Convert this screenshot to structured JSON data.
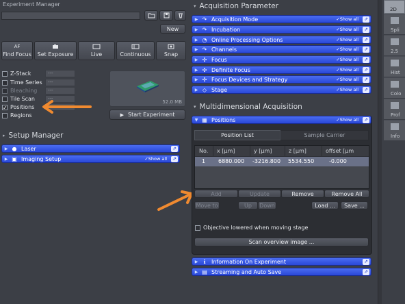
{
  "experiment_manager": {
    "title": "Experiment Manager",
    "new_label": "New",
    "acq_buttons": [
      {
        "icon": "AF",
        "label": "Find Focus"
      },
      {
        "icon": "camera-icon",
        "label": "Set Exposure"
      },
      {
        "icon": "live-icon",
        "label": "Live"
      },
      {
        "icon": "continuous-icon",
        "label": "Continuous"
      },
      {
        "icon": "snap-icon",
        "label": "Snap"
      }
    ],
    "options": [
      {
        "label": "Z-Stack",
        "checked": false,
        "value": "---"
      },
      {
        "label": "Time Series",
        "checked": false,
        "value": "---"
      },
      {
        "label": "Bleaching",
        "checked": false,
        "value": "---"
      },
      {
        "label": "Tile Scan",
        "checked": false,
        "value": "---"
      },
      {
        "label": "Positions",
        "checked": true,
        "value": "---"
      },
      {
        "label": "Regions",
        "checked": false,
        "value": ""
      }
    ],
    "preview_size": "52.0 MB",
    "start_label": "Start Experiment"
  },
  "setup_manager": {
    "title": "Setup Manager",
    "items": [
      {
        "label": "Laser",
        "show_all": ""
      },
      {
        "label": "Imaging Setup",
        "show_all": "Show all"
      }
    ]
  },
  "acquisition_parameter": {
    "title": "Acquisition Parameter",
    "items": [
      {
        "label": "Acquisition Mode",
        "show_all": "Show all"
      },
      {
        "label": "Incubation",
        "show_all": "Show all"
      },
      {
        "label": "Online Processing Options",
        "show_all": "Show all"
      },
      {
        "label": "Channels",
        "show_all": "Show all"
      },
      {
        "label": "Focus",
        "show_all": "Show all"
      },
      {
        "label": "Definite Focus",
        "show_all": "Show all"
      },
      {
        "label": "Focus Devices and Strategy",
        "show_all": "Show all"
      },
      {
        "label": "Stage",
        "show_all": "Show all"
      }
    ]
  },
  "multidimensional": {
    "title": "Multidimensional Acquisition",
    "positions": {
      "label": "Positions",
      "show_all": "Show all",
      "tabs": [
        "Position List",
        "Sample Carrier"
      ],
      "columns": [
        "No.",
        "x [µm]",
        "y [µm]",
        "z [µm]",
        "offset [µm"
      ],
      "rows": [
        [
          "1",
          "6880.000",
          "-3216.800",
          "5534.550",
          "-0.000"
        ]
      ],
      "buttons": {
        "add": "Add",
        "update": "Update",
        "remove": "Remove",
        "remove_all": "Remove All",
        "move_to": "Move to",
        "up": "Up",
        "down": "Down",
        "load": "Load ...",
        "save": "Save ..."
      },
      "objective_label": "Objective lowered when moving stage",
      "scan_label": "Scan overview image ..."
    },
    "footer_items": [
      {
        "label": "Information On Experiment"
      },
      {
        "label": "Streaming and Auto Save"
      }
    ]
  },
  "right_strip": {
    "items": [
      "2D",
      "Spli",
      "2.5",
      "Hist",
      "Colo",
      "Prof",
      "Info"
    ]
  },
  "colors": {
    "accent_blue": "#2f50e0",
    "annotation_arrow": "#f08a30",
    "bg": "#3c3f46"
  }
}
